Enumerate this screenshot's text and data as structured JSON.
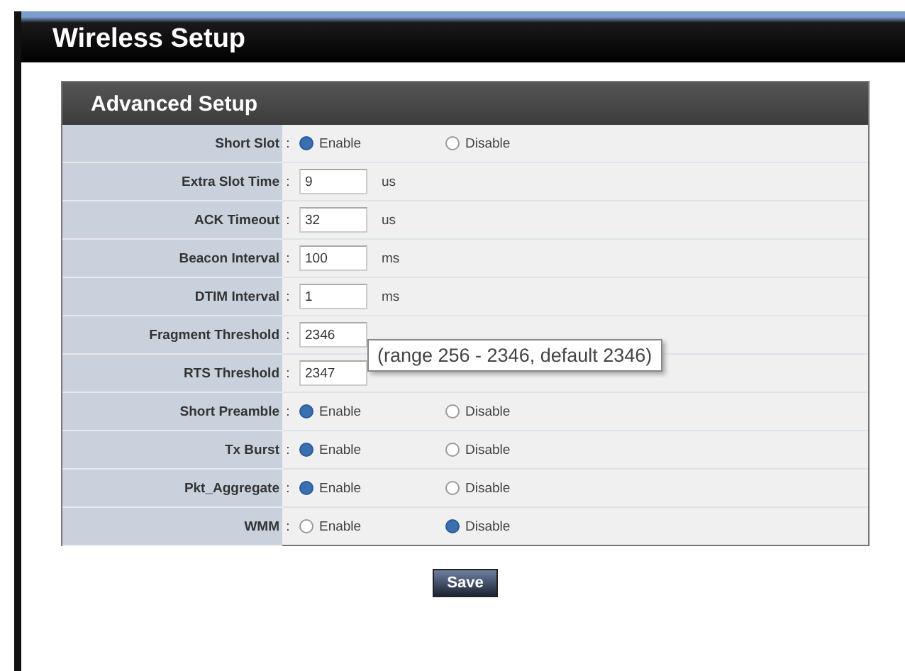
{
  "window": {
    "title": "Wireless Setup"
  },
  "panel": {
    "title": "Advanced Setup"
  },
  "rows": [
    {
      "kind": "radio",
      "label": "Short Slot",
      "separator": ":",
      "options": [
        {
          "label": "Enable",
          "selected": true
        },
        {
          "label": "Disable",
          "selected": false
        }
      ]
    },
    {
      "kind": "text",
      "label": "Extra Slot Time",
      "separator": ":",
      "value": "9",
      "unit": "us"
    },
    {
      "kind": "text",
      "label": "ACK Timeout",
      "separator": ":",
      "value": "32",
      "unit": "us"
    },
    {
      "kind": "text",
      "label": "Beacon Interval",
      "separator": ":",
      "value": "100",
      "unit": "ms"
    },
    {
      "kind": "text",
      "label": "DTIM Interval",
      "separator": ":",
      "value": "1",
      "unit": "ms"
    },
    {
      "kind": "text",
      "label": "Fragment Threshold",
      "separator": ":",
      "value": "2346"
    },
    {
      "kind": "text",
      "label": "RTS Threshold",
      "separator": ":",
      "value": "2347",
      "tooltip": "(range 256 - 2346, default 2346)"
    },
    {
      "kind": "radio",
      "label": "Short Preamble",
      "separator": ":",
      "options": [
        {
          "label": "Enable",
          "selected": true
        },
        {
          "label": "Disable",
          "selected": false
        }
      ]
    },
    {
      "kind": "radio",
      "label": "Tx Burst",
      "separator": ":",
      "options": [
        {
          "label": "Enable",
          "selected": true
        },
        {
          "label": "Disable",
          "selected": false
        }
      ]
    },
    {
      "kind": "radio",
      "label": "Pkt_Aggregate",
      "separator": ":",
      "options": [
        {
          "label": "Enable",
          "selected": true
        },
        {
          "label": "Disable",
          "selected": false
        }
      ]
    },
    {
      "kind": "radio",
      "label": "WMM",
      "separator": ":",
      "options": [
        {
          "label": "Enable",
          "selected": false
        },
        {
          "label": "Disable",
          "selected": true
        }
      ]
    }
  ],
  "save_button": "Save"
}
